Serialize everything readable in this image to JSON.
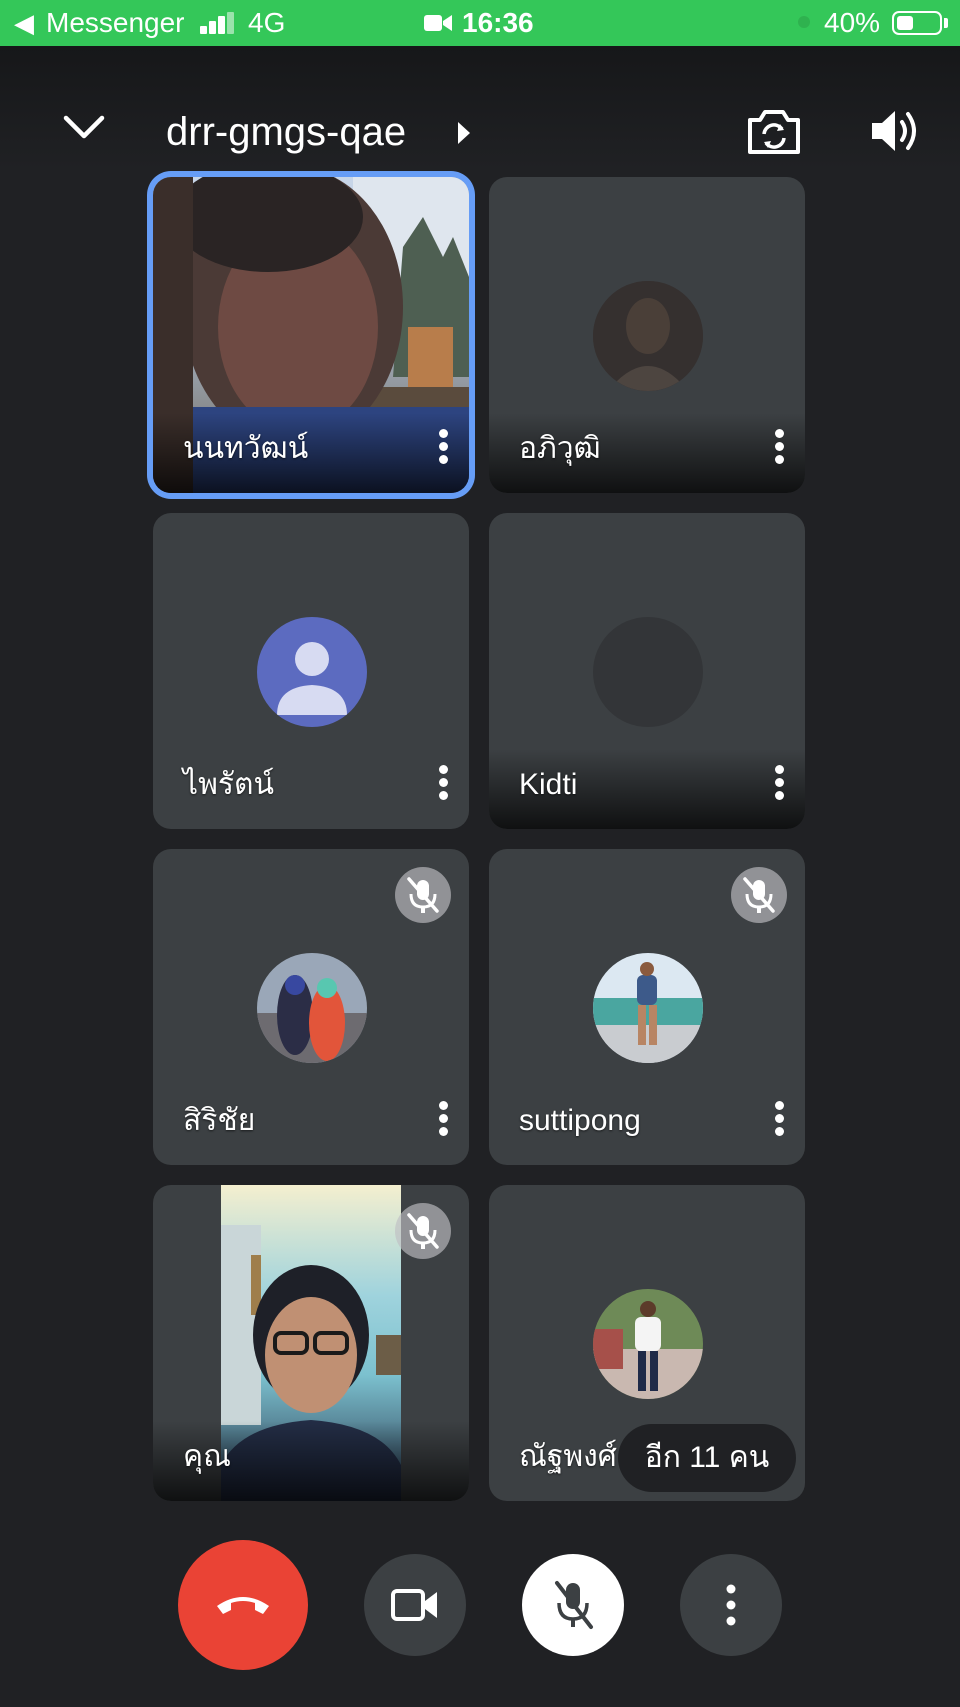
{
  "status_bar": {
    "back_label": "Messenger",
    "network": "4G",
    "time": "16:36",
    "battery": "40%",
    "battery_level": 0.4,
    "background_color": "#34c759"
  },
  "header": {
    "meeting_code": "drr-gmgs-qae",
    "icons": [
      "chevron-down-icon",
      "chevron-right-icon",
      "flip-camera-icon",
      "speaker-icon"
    ]
  },
  "participants": [
    {
      "name": "นนทวัฒน์",
      "muted": false,
      "view": "video",
      "active_speaker": true
    },
    {
      "name": "อภิวุฒิ",
      "muted": false,
      "view": "dim-photo"
    },
    {
      "name": "ไพรัตน์",
      "muted": false,
      "view": "default-avatar"
    },
    {
      "name": "Kidti",
      "muted": false,
      "view": "dark-avatar"
    },
    {
      "name": "สิริชัย",
      "muted": true,
      "view": "photo"
    },
    {
      "name": "suttipong",
      "muted": true,
      "view": "photo"
    },
    {
      "name": "คุณ",
      "muted": true,
      "view": "video"
    },
    {
      "name": "ณัฐพงศ์",
      "muted": false,
      "view": "photo"
    }
  ],
  "overflow": {
    "label": "อีก 11 คน"
  },
  "controls": {
    "icons": [
      "end-call-icon",
      "video-camera-icon",
      "mic-off-icon",
      "more-vert-icon"
    ],
    "end_call_color": "#ea4335",
    "highlight_color": "#669df6"
  }
}
